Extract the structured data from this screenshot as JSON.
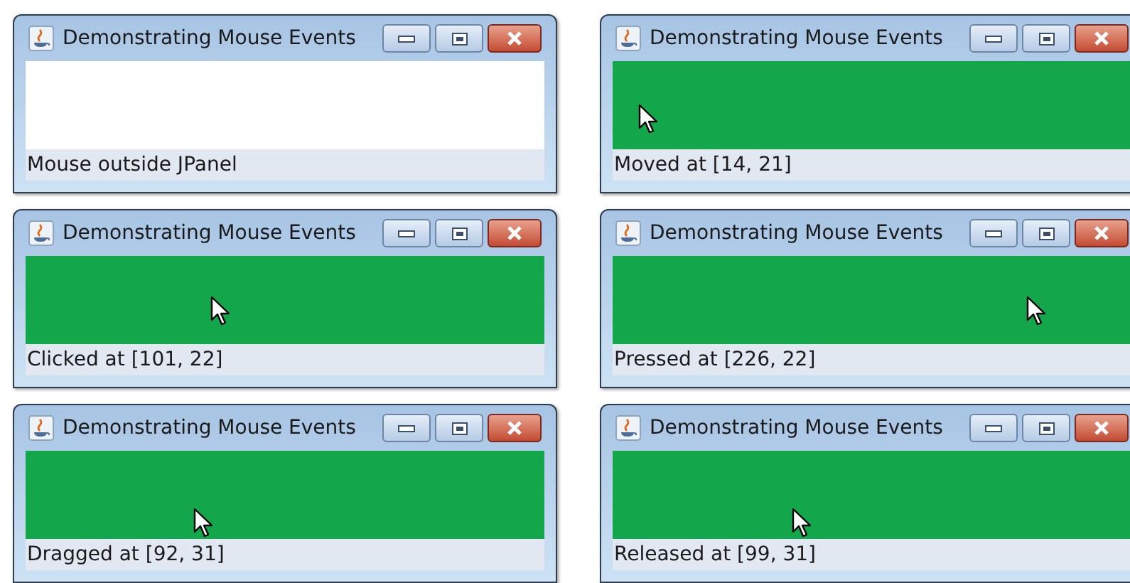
{
  "windows": [
    {
      "title": "Demonstrating Mouse Events",
      "panel_active": false,
      "status": "Mouse outside JPanel"
    },
    {
      "title": "Demonstrating Mouse Events",
      "panel_active": true,
      "status": "Moved at [14, 21]"
    },
    {
      "title": "Demonstrating Mouse Events",
      "panel_active": true,
      "status": "Clicked at [101, 22]"
    },
    {
      "title": "Demonstrating Mouse Events",
      "panel_active": true,
      "status": "Pressed at [226, 22]"
    },
    {
      "title": "Demonstrating Mouse Events",
      "panel_active": true,
      "status": "Dragged at [92, 31]"
    },
    {
      "title": "Demonstrating Mouse Events",
      "panel_active": true,
      "status": "Released at [99, 31]"
    }
  ]
}
